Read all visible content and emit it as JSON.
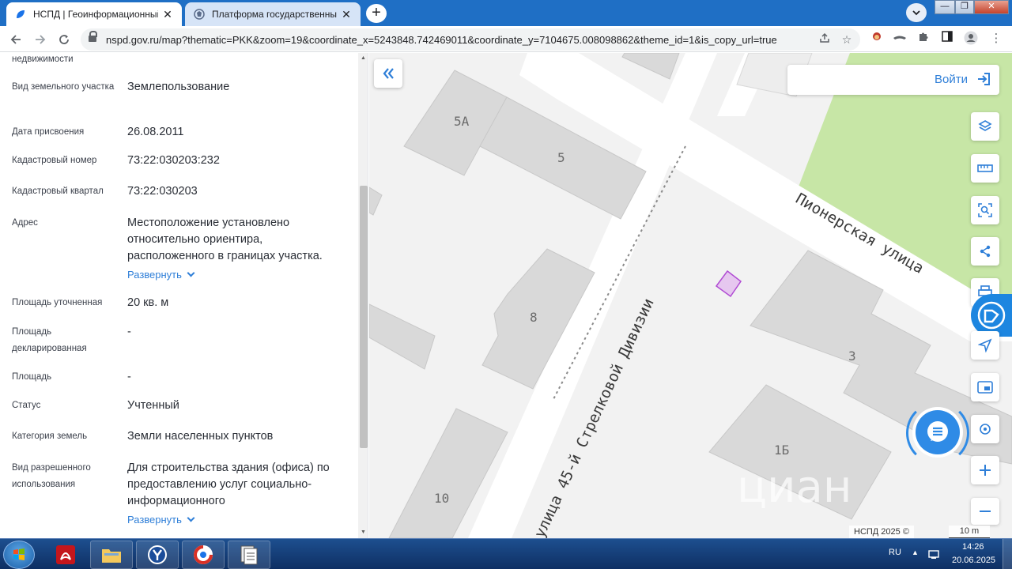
{
  "browser": {
    "tabs": [
      {
        "title": "НСПД | Геоинформационный п",
        "active": true
      },
      {
        "title": "Платформа государственных се",
        "active": false
      }
    ],
    "new_tab_label": "+",
    "url": "nspd.gov.ru/map?thematic=PKK&zoom=19&coordinate_x=5243848.742469011&coordinate_y=7104675.008098862&theme_id=1&is_copy_url=true",
    "window_controls": [
      "—",
      "❐",
      "✕"
    ]
  },
  "panel": {
    "fields": [
      {
        "label": "недвижимости",
        "value": ""
      },
      {
        "label": "Вид земельного участка",
        "value": "Землепользование"
      },
      {
        "label": "Дата присвоения",
        "value": "26.08.2011"
      },
      {
        "label": "Кадастровый номер",
        "value": "73:22:030203:232"
      },
      {
        "label": "Кадастровый квартал",
        "value": "73:22:030203"
      },
      {
        "label": "Адрес",
        "value": "Местоположение установлено относительно ориентира, расположенного в границах участка."
      },
      {
        "label": "Площадь уточненная",
        "value": "20 кв. м"
      },
      {
        "label": "Площадь декларированная",
        "value": "-"
      },
      {
        "label": "Площадь",
        "value": "-"
      },
      {
        "label": "Статус",
        "value": "Учтенный"
      },
      {
        "label": "Категория земель",
        "value": "Земли населенных пунктов"
      },
      {
        "label": "Вид разрешенного использования",
        "value": "Для строительства здания (офиса) по предоставлению услуг социально-информационного"
      }
    ],
    "expand_label": "Развернуть"
  },
  "map": {
    "login_label": "Войти",
    "streets": [
      "Пионерская улица",
      "улица 45-й Стрелковой Дивизии"
    ],
    "buildings": [
      "5А",
      "5",
      "8",
      "3",
      "1Б",
      "10"
    ],
    "attribution": "НСПД 2025 ©",
    "scale_label": "10 m",
    "watermark": "циан",
    "colors": {
      "park": "#c7e6a6",
      "road": "#ffffff",
      "building": "#d9d9d9",
      "parcel": "#b04bd3",
      "accent": "#2f7fd8"
    }
  },
  "taskbar": {
    "language": "RU",
    "time": "14:26",
    "date": "20.06.2025"
  }
}
